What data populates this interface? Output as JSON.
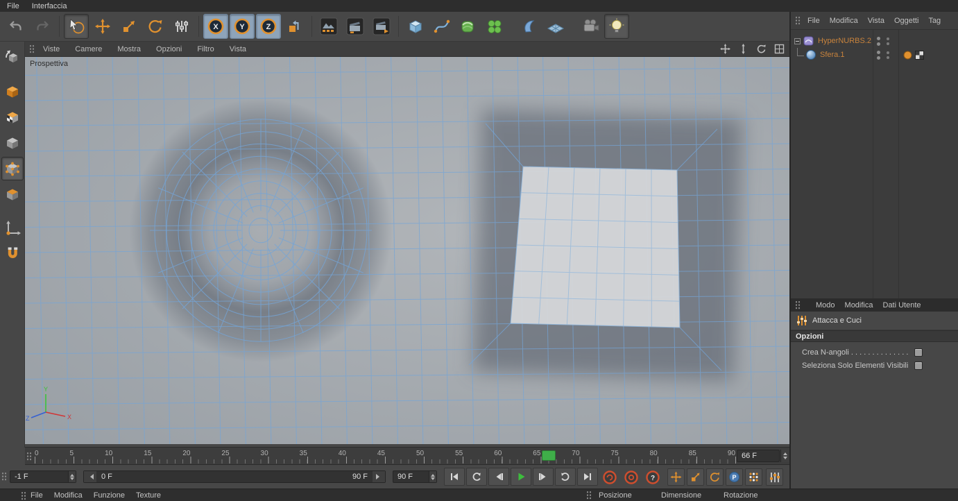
{
  "colors": {
    "accent_orange": "#e0912f",
    "wire_blue": "#74a5d8",
    "play_green": "#3dbd3d",
    "marker_green": "#3fae49",
    "object_name_orange": "#c8833c"
  },
  "menubar": {
    "items": [
      {
        "label": "File"
      },
      {
        "label": "Interfaccia"
      }
    ]
  },
  "toolbar": {
    "axis_locks": [
      {
        "label": "X"
      },
      {
        "label": "Y"
      },
      {
        "label": "Z"
      }
    ]
  },
  "viewport": {
    "camera_label": "Prospettiva",
    "menu": [
      {
        "label": "Viste"
      },
      {
        "label": "Camere"
      },
      {
        "label": "Mostra"
      },
      {
        "label": "Opzioni"
      },
      {
        "label": "Filtro"
      },
      {
        "label": "Vista"
      }
    ],
    "axis": {
      "x": "X",
      "y": "Y",
      "z": "Z"
    }
  },
  "timeline": {
    "ticks": [
      {
        "label": "0"
      },
      {
        "label": "5"
      },
      {
        "label": "10"
      },
      {
        "label": "15"
      },
      {
        "label": "20"
      },
      {
        "label": "25"
      },
      {
        "label": "30"
      },
      {
        "label": "35"
      },
      {
        "label": "40"
      },
      {
        "label": "45"
      },
      {
        "label": "50"
      },
      {
        "label": "55"
      },
      {
        "label": "60"
      },
      {
        "label": "65"
      },
      {
        "label": "70"
      },
      {
        "label": "75"
      },
      {
        "label": "80"
      },
      {
        "label": "85"
      },
      {
        "label": "90"
      }
    ],
    "marker_frame": 66,
    "current_frame_field": "66 F",
    "start_field": "-1 F",
    "range_start_label": "0 F",
    "range_end_label": "90 F",
    "end_field": "90 F"
  },
  "anim": {
    "param_label": "P",
    "help_label": "?"
  },
  "status_bar": {
    "left_menu": [
      {
        "label": "File"
      },
      {
        "label": "Modifica"
      },
      {
        "label": "Funzione"
      },
      {
        "label": "Texture"
      }
    ],
    "coord_headers": [
      {
        "label": "Posizione"
      },
      {
        "label": "Dimensione"
      },
      {
        "label": "Rotazione"
      }
    ]
  },
  "object_manager": {
    "menu": [
      {
        "label": "File"
      },
      {
        "label": "Modifica"
      },
      {
        "label": "Vista"
      },
      {
        "label": "Oggetti"
      },
      {
        "label": "Tag"
      }
    ],
    "objects": [
      {
        "name": "HyperNURBS.2"
      },
      {
        "name": "Sfera.1"
      }
    ]
  },
  "attribute_manager": {
    "tabs": [
      {
        "label": "Modo"
      },
      {
        "label": "Modifica"
      },
      {
        "label": "Dati Utente"
      }
    ],
    "tool_title": "Attacca e Cuci",
    "section_title": "Opzioni",
    "options": [
      {
        "label": "Crea N-angoli . . . . . . . . . . . . . ."
      },
      {
        "label": "Seleziona Solo Elementi Visibili"
      }
    ]
  }
}
